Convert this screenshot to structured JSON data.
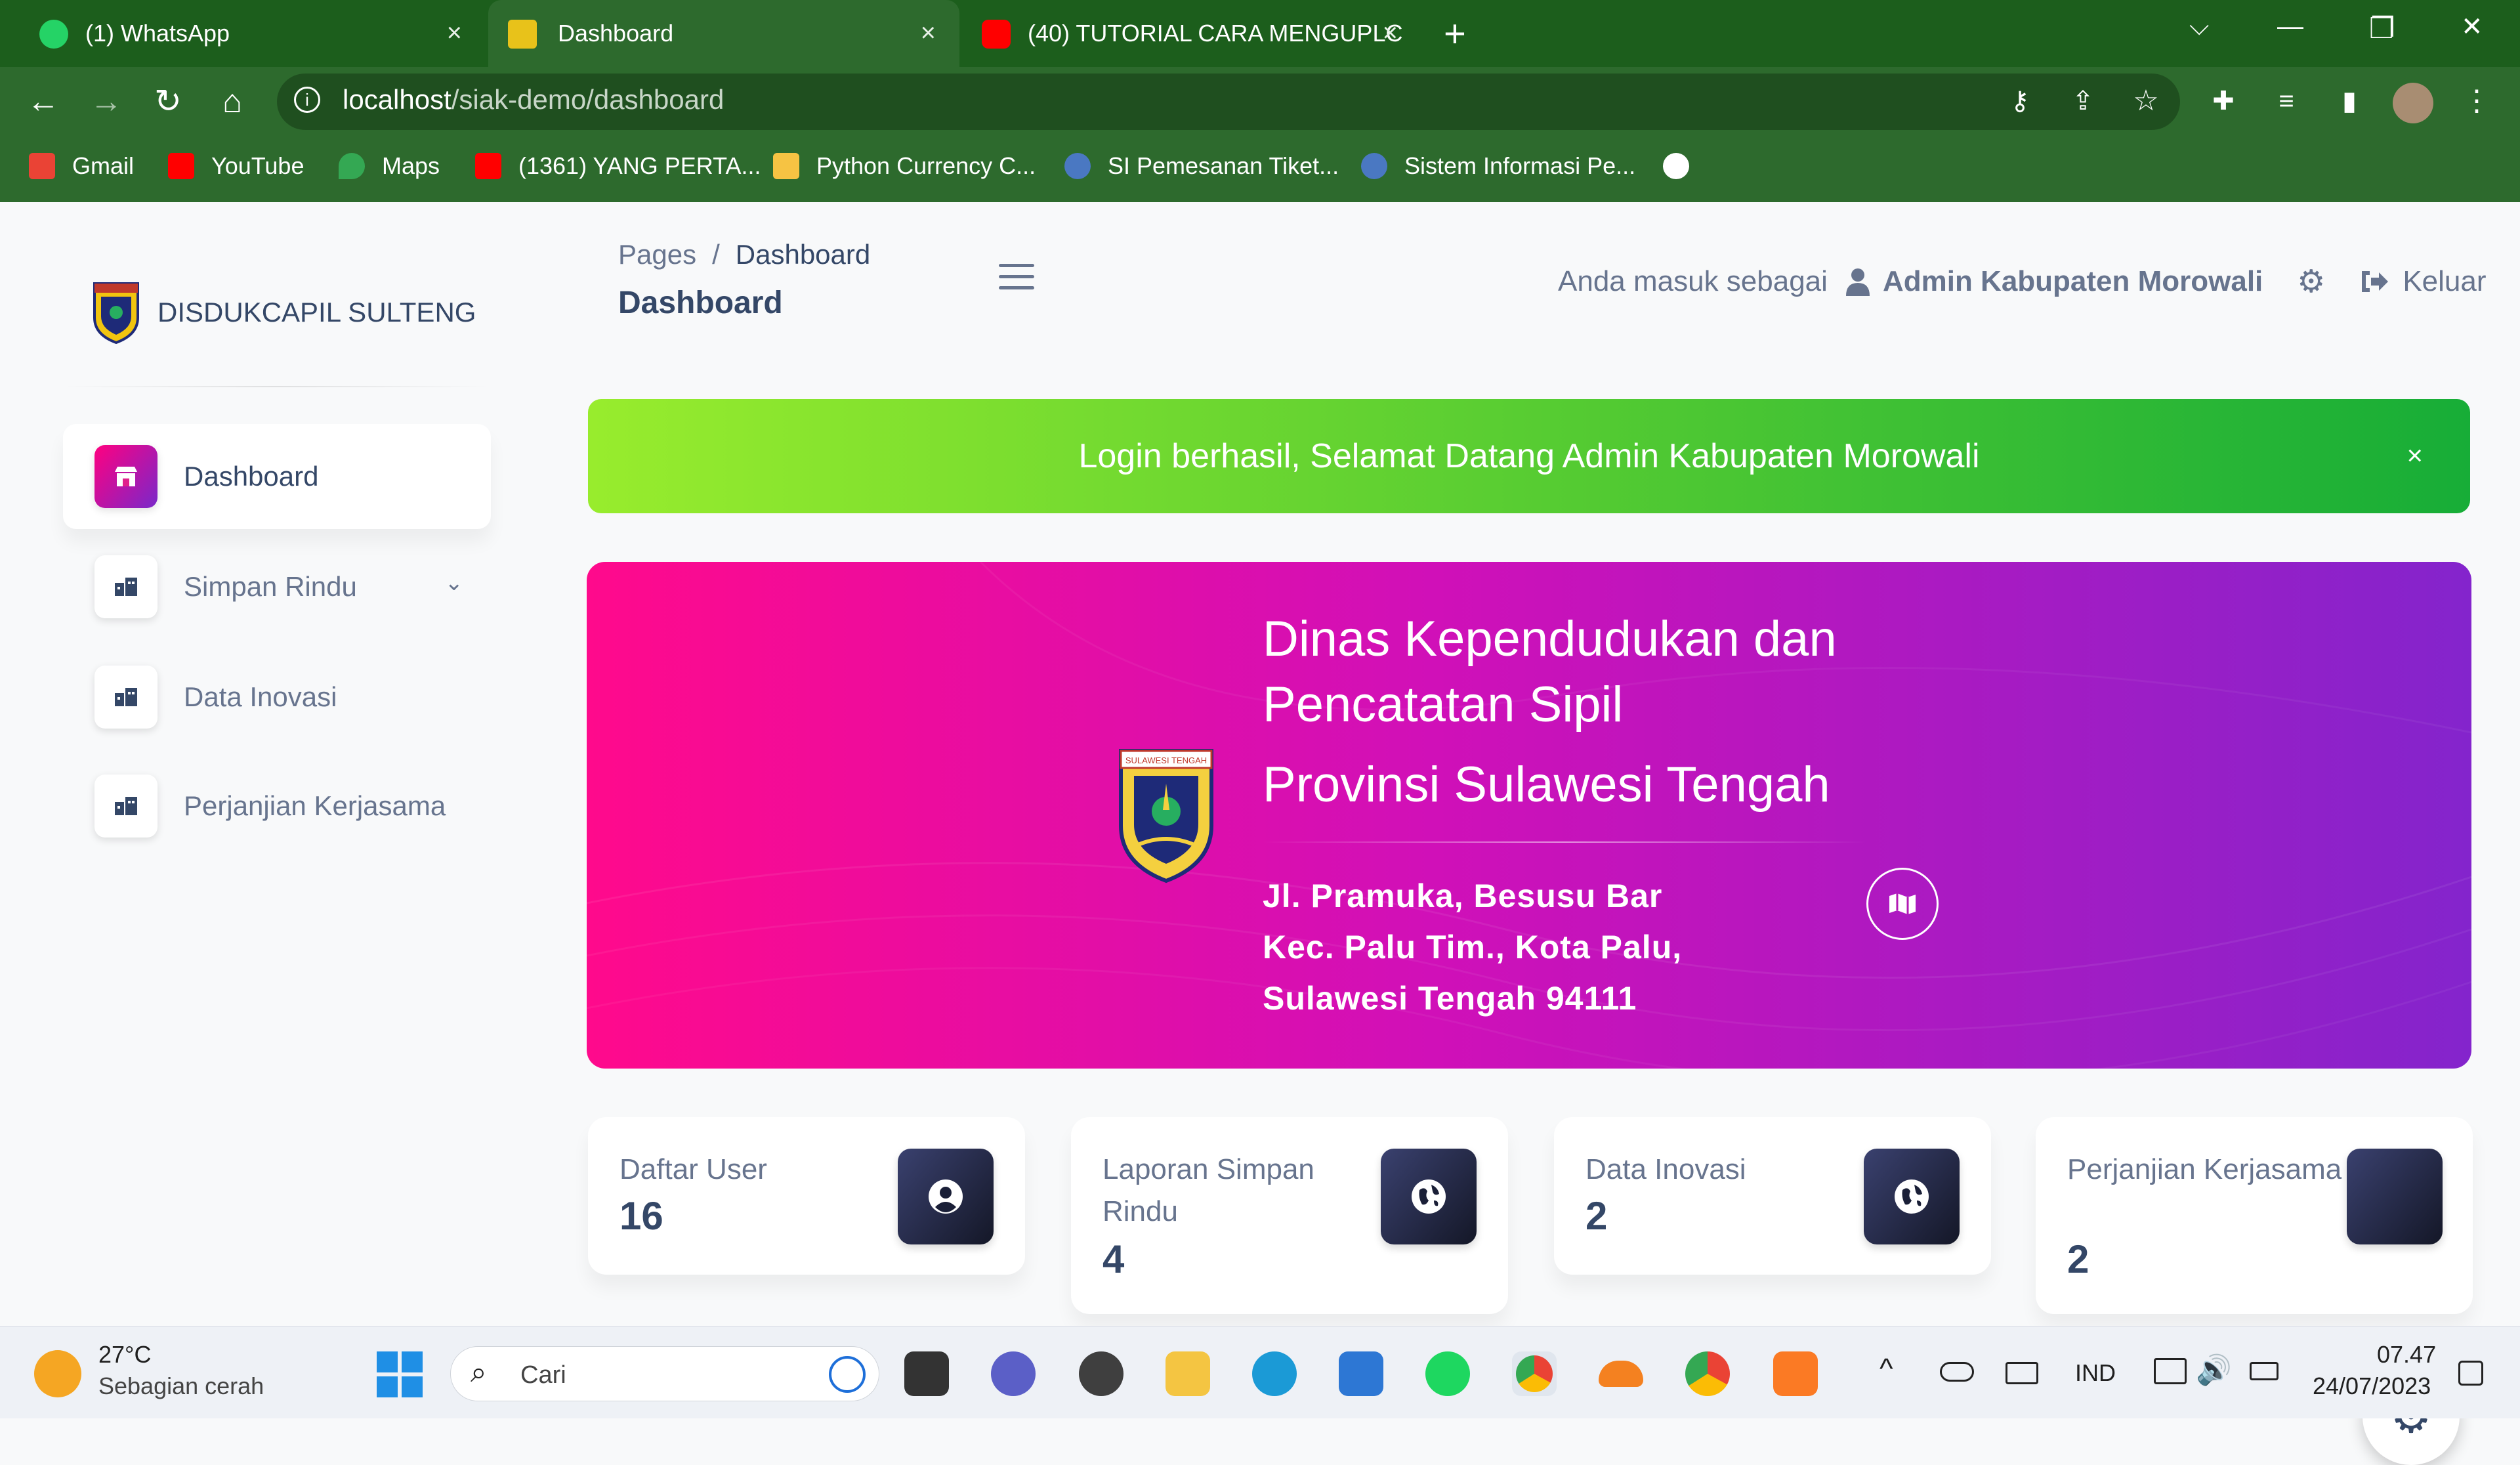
{
  "browser": {
    "tabs": [
      {
        "label": "(1) WhatsApp",
        "close": "×"
      },
      {
        "label": "Dashboard",
        "close": "×"
      },
      {
        "label": "(40) TUTORIAL CARA MENGUPLC",
        "close": "×"
      }
    ],
    "new_tab": "+",
    "url_host": "localhost",
    "url_path": "/siak-demo/dashboard",
    "bookmarks": [
      "Gmail",
      "YouTube",
      "Maps",
      "(1361) YANG PERTA...",
      "Python Currency C...",
      "SI Pemesanan Tiket...",
      "Sistem Informasi Pe..."
    ],
    "window_controls": {
      "dropdown": "⌵",
      "minimize": "—",
      "restore": "❐",
      "close": "✕"
    }
  },
  "sidebar": {
    "brand": "DISDUKCAPIL SULTENG",
    "items": [
      {
        "label": "Dashboard",
        "active": true
      },
      {
        "label": "Simpan Rindu",
        "active": false
      },
      {
        "label": "Data Inovasi",
        "active": false
      },
      {
        "label": "Perjanjian Kerjasama",
        "active": false
      }
    ]
  },
  "header": {
    "breadcrumb_root": "Pages",
    "breadcrumb_sep": "/",
    "breadcrumb_current": "Dashboard",
    "title": "Dashboard",
    "user_prefix": "Anda masuk sebagai",
    "user_name": "Admin Kabupaten Morowali",
    "logout": "Keluar"
  },
  "alert": {
    "message": "Login berhasil, Selamat Datang Admin Kabupaten Morowali",
    "close": "×"
  },
  "hero": {
    "title_line1": "Dinas Kependudukan dan",
    "title_line2": "Pencatatan Sipil",
    "title_line3": "Provinsi Sulawesi Tengah",
    "address_line1": "Jl. Pramuka, Besusu Bar",
    "address_line2": "Kec. Palu Tim., Kota Palu,",
    "address_line3": "Sulawesi Tengah 94111",
    "logo_text": "SULAWESI TENGAH"
  },
  "stats": [
    {
      "label": "Daftar User",
      "value": "16",
      "icon": "user-circle-icon"
    },
    {
      "label": "Laporan Simpan Rindu",
      "value": "4",
      "icon": "globe-icon"
    },
    {
      "label": "Data Inovasi",
      "value": "2",
      "icon": "globe-icon"
    },
    {
      "label": "Perjanjian Kerjasama",
      "value": "2",
      "icon": "globe-icon"
    }
  ],
  "taskbar": {
    "weather_temp": "27°C",
    "weather_desc": "Sebagian cerah",
    "search_placeholder": "Cari",
    "language": "IND",
    "time": "07.47",
    "date": "24/07/2023"
  },
  "colors": {
    "browser_frame": "#2d6a2d",
    "alert_start": "#98ec2d",
    "alert_end": "#17ad37",
    "hero_start": "#ff0a8c",
    "hero_end": "#8424cc",
    "text_primary": "#344767",
    "text_secondary": "#67748e"
  }
}
